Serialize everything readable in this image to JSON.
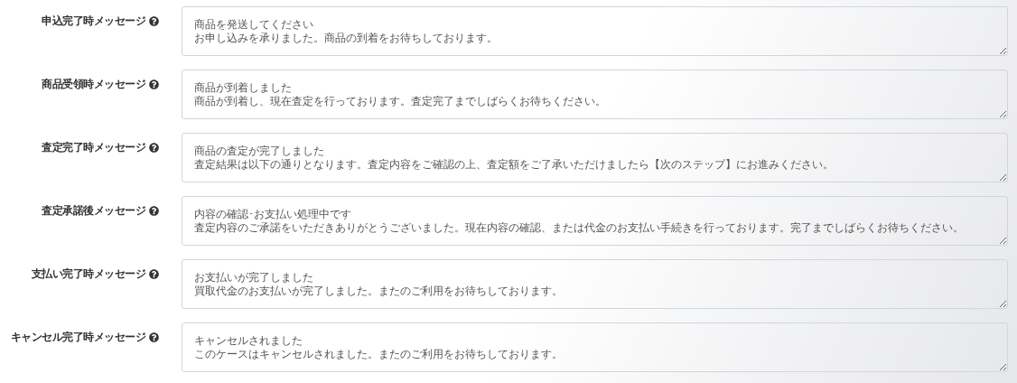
{
  "fields": [
    {
      "label": "申込完了時メッセージ",
      "title": "商品を発送してください",
      "body": "お申し込みを承りました。商品の到着をお待ちしております。"
    },
    {
      "label": "商品受領時メッセージ",
      "title": "商品が到着しました",
      "body": "商品が到着し、現在査定を行っております。査定完了までしばらくお待ちください。"
    },
    {
      "label": "査定完了時メッセージ",
      "title": "商品の査定が完了しました",
      "body": "査定結果は以下の通りとなります。査定内容をご確認の上、査定額をご了承いただけましたら【次のステップ】にお進みください。"
    },
    {
      "label": "査定承諾後メッセージ",
      "title": "内容の確認･お支払い処理中です",
      "body": "査定内容のご承諾をいただきありがとうございました。現在内容の確認、または代金のお支払い手続きを行っております。完了までしばらくお待ちください。"
    },
    {
      "label": "支払い完了時メッセージ",
      "title": "お支払いが完了しました",
      "body": "買取代金のお支払いが完了しました。またのご利用をお待ちしております。"
    },
    {
      "label": "キャンセル完了時メッセージ",
      "title": "キャンセルされました",
      "body": "このケースはキャンセルされました。またのご利用をお待ちしております。"
    }
  ]
}
